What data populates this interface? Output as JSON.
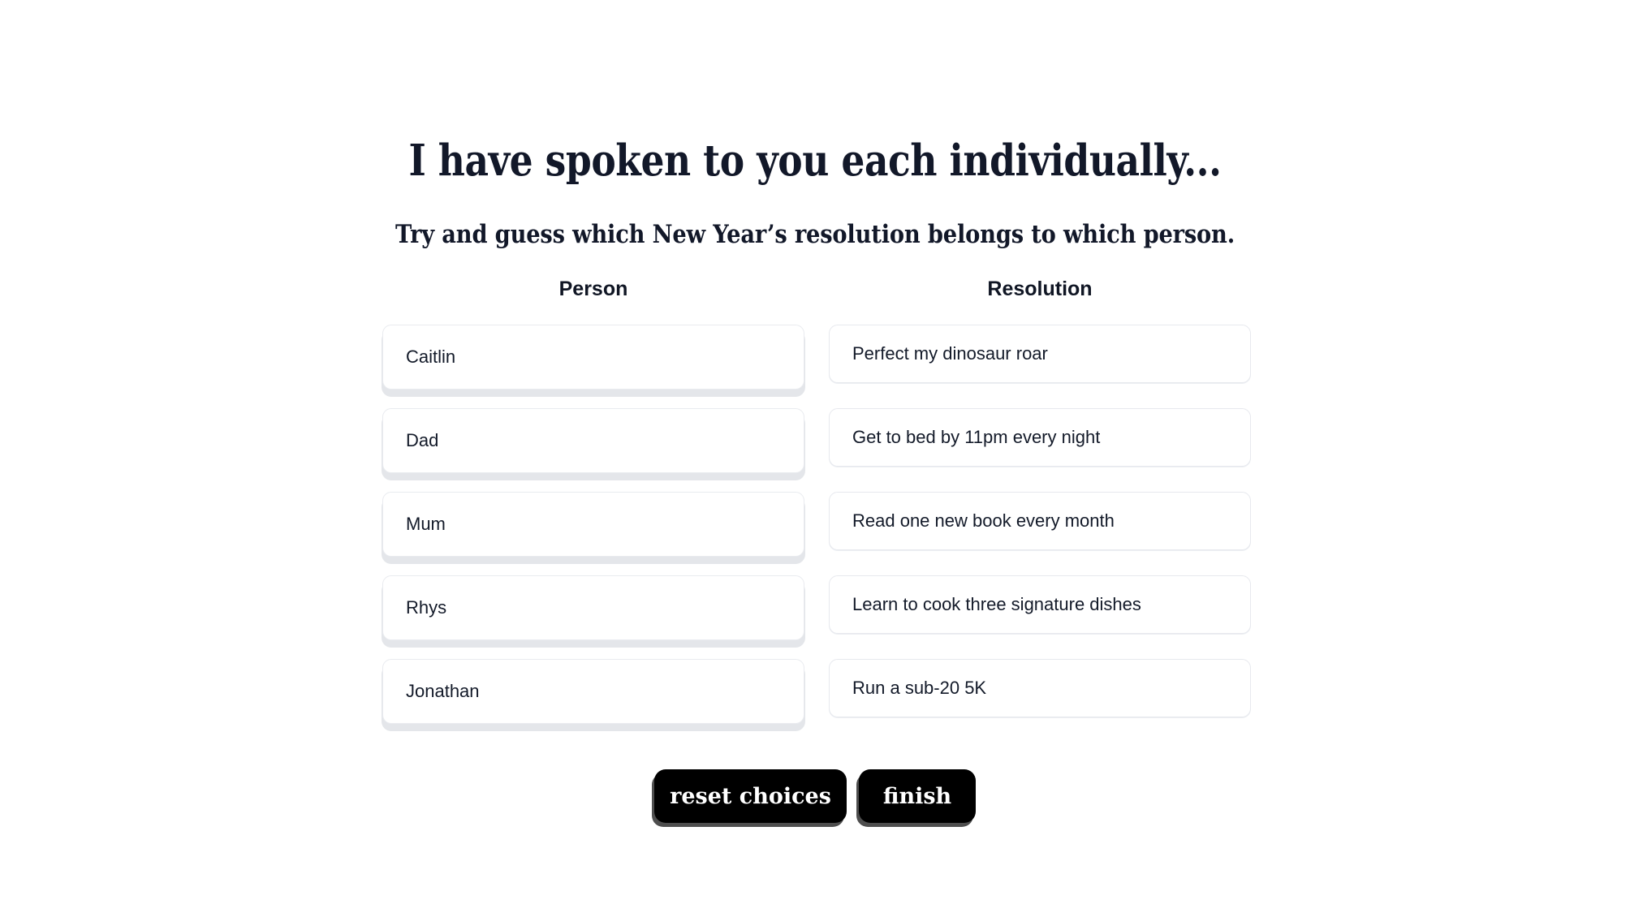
{
  "page": {
    "title": "I have spoken to you each individually...",
    "subtitle": "Try and guess which New Year’s resolution belongs to which person.",
    "background_color": "#ffffff",
    "text_color": "#121829"
  },
  "columns": {
    "person": {
      "header": "Person",
      "items": [
        {
          "label": "Caitlin"
        },
        {
          "label": "Dad"
        },
        {
          "label": "Mum"
        },
        {
          "label": "Rhys"
        },
        {
          "label": "Jonathan"
        }
      ]
    },
    "resolution": {
      "header": "Resolution",
      "items": [
        {
          "label": "Perfect my dinosaur roar"
        },
        {
          "label": "Get to bed by 11pm every night"
        },
        {
          "label": "Read one new book every month"
        },
        {
          "label": "Learn to cook three signature dishes"
        },
        {
          "label": "Run a sub-20 5K"
        }
      ]
    }
  },
  "buttons": {
    "reset": "reset choices",
    "finish": "finish",
    "background_color": "#000000",
    "text_color": "#ffffff",
    "shadow_color": "#4e4e4e"
  },
  "card_style": {
    "background_color": "#ffffff",
    "border_color": "#e7e9ee",
    "shadow_color": "#e4e6ea"
  }
}
